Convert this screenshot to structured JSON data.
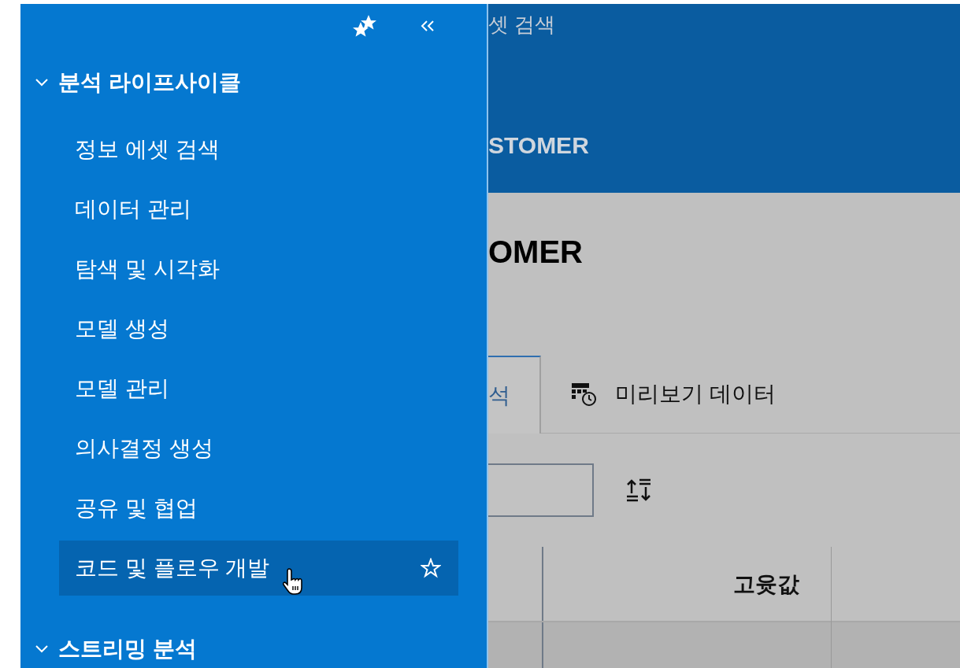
{
  "sidebar": {
    "groups": [
      {
        "label": "분석 라이프사이클",
        "expanded": true,
        "items": [
          {
            "label": "정보 에셋 검색",
            "highlighted": false
          },
          {
            "label": "데이터 관리",
            "highlighted": false
          },
          {
            "label": "탐색 및 시각화",
            "highlighted": false
          },
          {
            "label": "모델 생성",
            "highlighted": false
          },
          {
            "label": "모델 관리",
            "highlighted": false
          },
          {
            "label": "의사결정 생성",
            "highlighted": false
          },
          {
            "label": "공유 및 협업",
            "highlighted": false
          },
          {
            "label": "코드 및 플로우 개발",
            "highlighted": true
          }
        ]
      },
      {
        "label": "스트리밍 분석",
        "expanded": true
      }
    ]
  },
  "header": {
    "breadcrumb": "셋 검색",
    "title": "STOMER"
  },
  "page_title": "OMER",
  "tabs": [
    {
      "label": "석",
      "selected": true
    },
    {
      "label": "미리보기 데이터",
      "selected": false
    }
  ],
  "table": {
    "columns": [
      "고윳값"
    ]
  }
}
